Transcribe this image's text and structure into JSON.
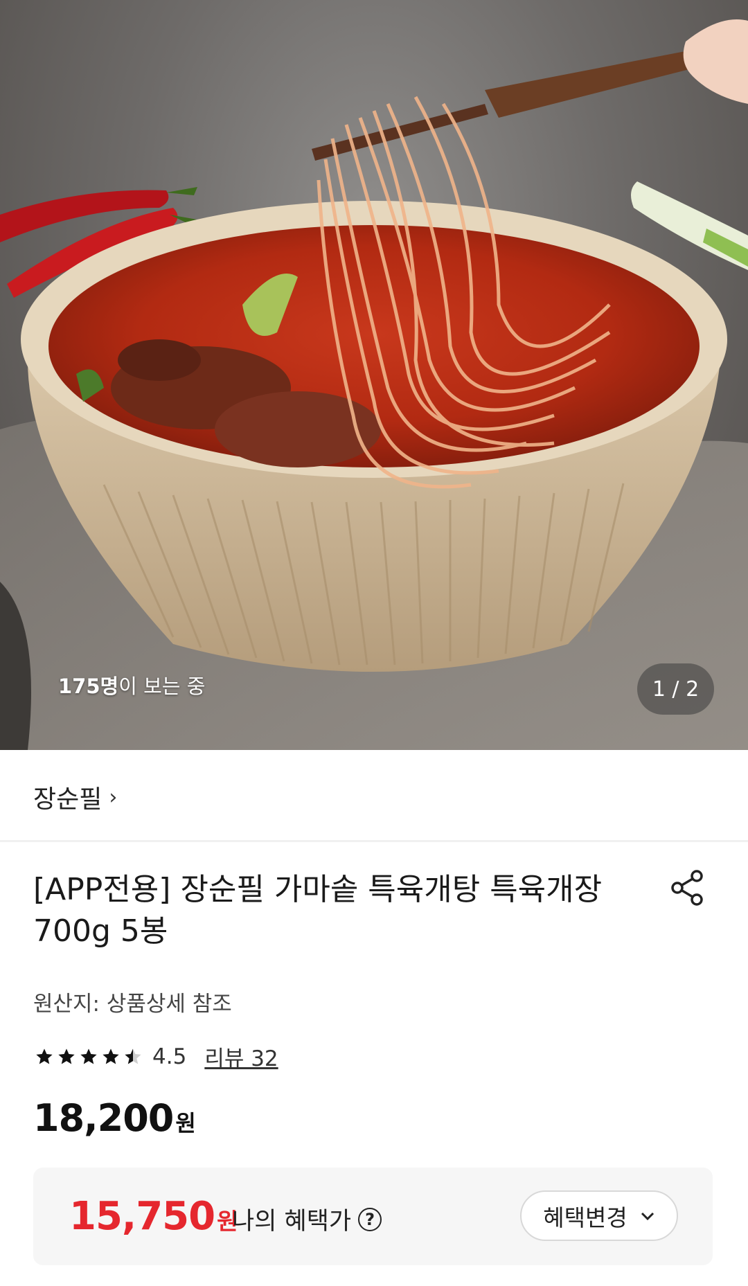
{
  "hero": {
    "viewers_count": "175명",
    "viewers_suffix": "이 보는 중",
    "pager": "1 / 2"
  },
  "brand": {
    "name": "장순필",
    "chevron": "›"
  },
  "product": {
    "title": "[APP전용] 장순필 가마솥 특육개탕 특육개장 700g 5봉",
    "origin": "원산지: 상품상세 참조",
    "rating": "4.5",
    "rating_value": 4.5,
    "reviews": "리뷰 32",
    "price": "18,200",
    "price_unit": "원"
  },
  "benefit": {
    "price": "15,750",
    "price_unit": "원",
    "label": "나의 혜택가",
    "help_icon": "?",
    "change_button": "혜택변경",
    "change_chevron": "⌄"
  },
  "colors": {
    "accent_red": "#e5272e",
    "box_bg": "#f6f6f6"
  },
  "icons": [
    "share-icon",
    "star-icon",
    "question-icon",
    "chevron-right-icon",
    "chevron-down-icon"
  ]
}
